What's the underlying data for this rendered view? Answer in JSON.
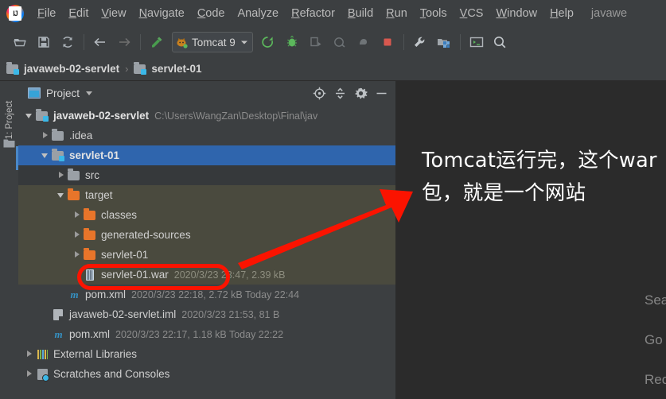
{
  "app": {
    "logo": "intellij-idea-logo",
    "project_name_in_menubar": "javawe"
  },
  "menubar": {
    "items": [
      {
        "label": "File",
        "mnemonic": true
      },
      {
        "label": "Edit",
        "mnemonic": true
      },
      {
        "label": "View",
        "mnemonic": true
      },
      {
        "label": "Navigate",
        "mnemonic": true
      },
      {
        "label": "Code",
        "mnemonic": true
      },
      {
        "label": "Analyze",
        "mnemonic": false
      },
      {
        "label": "Refactor",
        "mnemonic": true
      },
      {
        "label": "Build",
        "mnemonic": true
      },
      {
        "label": "Run",
        "mnemonic": true
      },
      {
        "label": "Tools",
        "mnemonic": true
      },
      {
        "label": "VCS",
        "mnemonic": true
      },
      {
        "label": "Window",
        "mnemonic": true
      },
      {
        "label": "Help",
        "mnemonic": true
      }
    ]
  },
  "toolbar": {
    "icons_left": [
      {
        "name": "open-project-icon"
      },
      {
        "name": "save-all-icon"
      },
      {
        "name": "sync-refresh-icon"
      },
      {
        "name": "navigate-back-icon"
      },
      {
        "name": "navigate-forward-icon"
      },
      {
        "name": "build-hammer-icon"
      }
    ],
    "run_config": {
      "label": "Tomcat 9",
      "icon": "tomcat-cat-icon",
      "dropdown": "chevron-down-icon"
    },
    "icons_right": [
      {
        "name": "run-icon"
      },
      {
        "name": "debug-icon"
      },
      {
        "name": "run-with-coverage-icon"
      },
      {
        "name": "profile-icon"
      },
      {
        "name": "attach-process-icon"
      },
      {
        "name": "stop-icon"
      },
      {
        "name": "settings-wrench-icon"
      },
      {
        "name": "project-structure-icon"
      },
      {
        "name": "terminal-icon"
      },
      {
        "name": "search-everywhere-icon"
      }
    ]
  },
  "navbar": {
    "crumbs": [
      {
        "label": "javaweb-02-servlet",
        "icon": "module-folder-icon"
      },
      {
        "label": "servlet-01",
        "icon": "module-folder-icon"
      }
    ],
    "separator": "›"
  },
  "leftbar": {
    "tab_label": "1: Project",
    "icon": "project-folder-icon"
  },
  "project_panel": {
    "title": "Project",
    "title_icon": "project-view-icon",
    "dropdown_icon": "chevron-down-icon",
    "actions": [
      {
        "name": "select-opened-file-icon"
      },
      {
        "name": "collapse-all-icon"
      },
      {
        "name": "settings-gear-icon"
      },
      {
        "name": "hide-panel-icon"
      }
    ]
  },
  "tree": {
    "nodes": [
      {
        "name": "javaweb-02-servlet",
        "meta": "C:\\Users\\WangZan\\Desktop\\Final\\jav",
        "icon": "module-folder-icon",
        "arrow": "open",
        "indent": 0,
        "bold": true,
        "state": "normal"
      },
      {
        "name": ".idea",
        "meta": "",
        "icon": "gray-folder-icon",
        "arrow": "closed",
        "indent": 1,
        "bold": false,
        "state": "normal"
      },
      {
        "name": "servlet-01",
        "meta": "",
        "icon": "module-folder-icon",
        "arrow": "open",
        "indent": 1,
        "bold": true,
        "state": "selected"
      },
      {
        "name": "src",
        "meta": "",
        "icon": "gray-folder-icon",
        "arrow": "closed",
        "indent": 2,
        "bold": false,
        "state": "hover"
      },
      {
        "name": "target",
        "meta": "",
        "icon": "orange-folder-icon",
        "arrow": "open",
        "indent": 2,
        "bold": false,
        "state": "excluded"
      },
      {
        "name": "classes",
        "meta": "",
        "icon": "orange-folder-icon",
        "arrow": "closed",
        "indent": 3,
        "bold": false,
        "state": "excluded"
      },
      {
        "name": "generated-sources",
        "meta": "",
        "icon": "orange-folder-icon",
        "arrow": "closed",
        "indent": 3,
        "bold": false,
        "state": "excluded"
      },
      {
        "name": "servlet-01",
        "meta": "",
        "icon": "orange-folder-icon",
        "arrow": "closed",
        "indent": 3,
        "bold": false,
        "state": "excluded"
      },
      {
        "name": "servlet-01.war",
        "meta": "2020/3/23 23:47, 2.39 kB",
        "icon": "war-archive-icon",
        "arrow": "none",
        "indent": 3,
        "bold": false,
        "state": "excluded"
      },
      {
        "name": "pom.xml",
        "meta": "2020/3/23 22:18, 2.72 kB Today 22:44",
        "icon": "maven-xml-icon",
        "arrow": "none",
        "indent": 2,
        "bold": false,
        "state": "normal"
      },
      {
        "name": "javaweb-02-servlet.iml",
        "meta": "2020/3/23 21:53, 81 B",
        "icon": "iml-module-file-icon",
        "arrow": "none",
        "indent": 1,
        "bold": false,
        "state": "normal"
      },
      {
        "name": "pom.xml",
        "meta": "2020/3/23 22:17, 1.18 kB Today 22:22",
        "icon": "maven-xml-icon",
        "arrow": "none",
        "indent": 1,
        "bold": false,
        "state": "normal"
      },
      {
        "name": "External Libraries",
        "meta": "",
        "icon": "libraries-icon",
        "arrow": "closed",
        "indent": 0,
        "bold": false,
        "state": "normal"
      },
      {
        "name": "Scratches and Consoles",
        "meta": "",
        "icon": "scratches-icon",
        "arrow": "closed",
        "indent": 0,
        "bold": false,
        "state": "normal"
      }
    ]
  },
  "editor": {
    "annotation_text": "Tomcat运行完，这个war包，就是一个网站",
    "hints": [
      {
        "text": "Search Everywhere"
      },
      {
        "text": "Go to File"
      },
      {
        "text": "Recent Files"
      }
    ]
  },
  "annotations": {
    "highlight_color": "#fb1300",
    "arrow": "red-arrow-pointing-up-right",
    "highlight_box_target": "servlet-01.war"
  },
  "colors": {
    "window_bg": "#3c3f41",
    "editor_bg": "#2b2b2b",
    "selection_blue": "#2f65ad",
    "excluded_olive": "#4a4a3e",
    "annotation_red": "#fb1300",
    "text_primary": "#d0d0d0",
    "text_muted": "#8c8c8c"
  }
}
